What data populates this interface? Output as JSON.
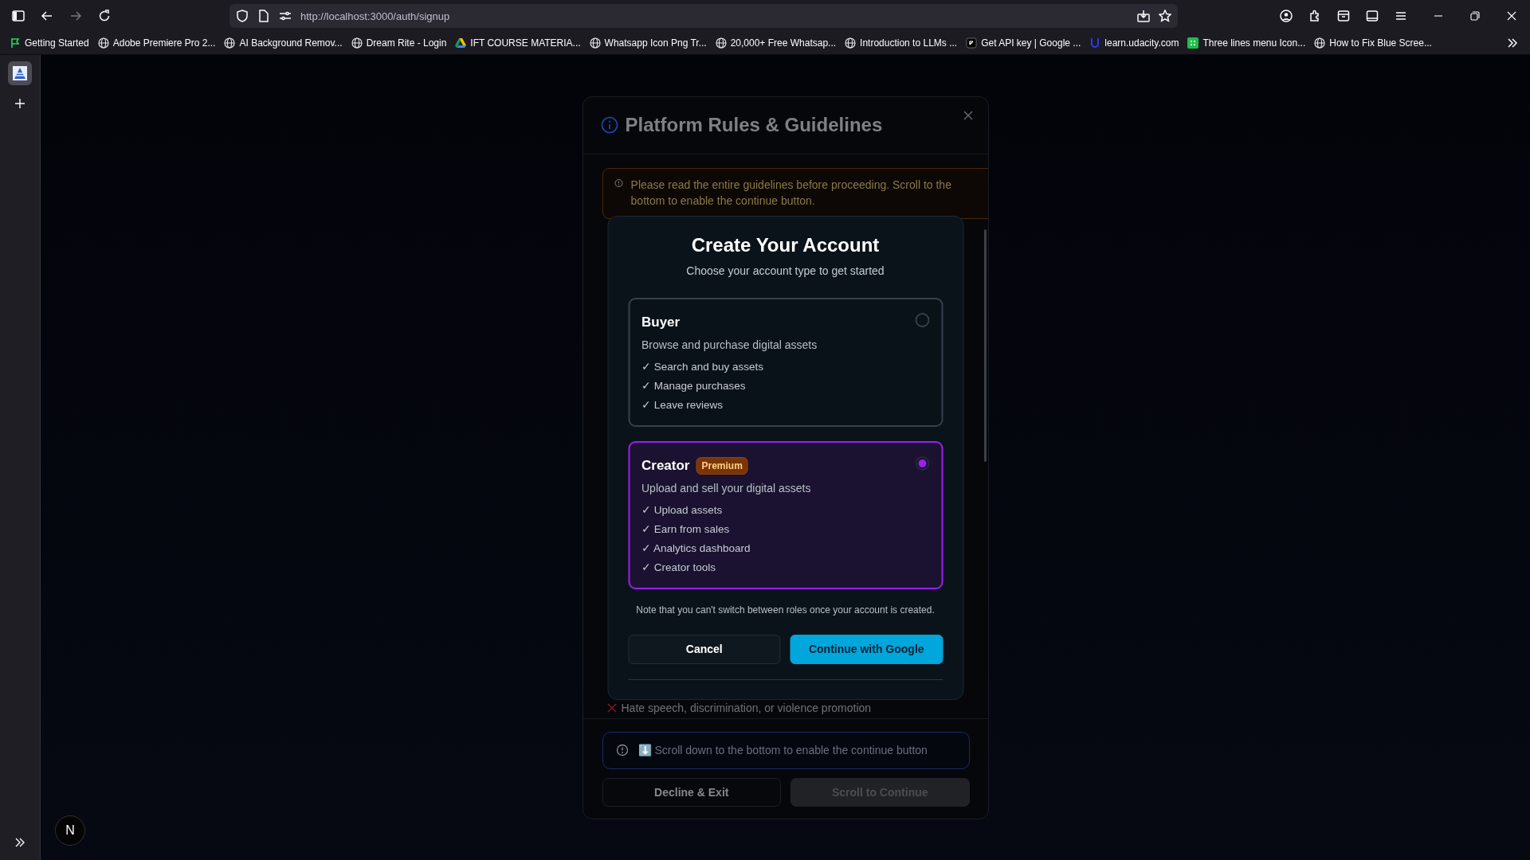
{
  "browser": {
    "url": "http://localhost:3000/auth/signup",
    "bookmarks": [
      {
        "label": "Getting Started",
        "kind": "flag"
      },
      {
        "label": "Adobe Premiere Pro 2...",
        "kind": "globe"
      },
      {
        "label": "AI Background Remov...",
        "kind": "globe"
      },
      {
        "label": "Dream Rite - Login",
        "kind": "globe"
      },
      {
        "label": "IFT COURSE MATERIA...",
        "kind": "drive"
      },
      {
        "label": "Whatsapp Icon Png Tr...",
        "kind": "globe"
      },
      {
        "label": "20,000+ Free Whatsap...",
        "kind": "globe"
      },
      {
        "label": "Introduction to LLMs ...",
        "kind": "globe"
      },
      {
        "label": "Get API key | Google ...",
        "kind": "page"
      },
      {
        "label": "learn.udacity.com",
        "kind": "udacity"
      },
      {
        "label": "Three lines menu Icon...",
        "kind": "sheet"
      },
      {
        "label": "How to Fix Blue Scree...",
        "kind": "globe"
      }
    ]
  },
  "dev_indicator": {
    "letter": "N"
  },
  "guidelines": {
    "title": "Platform Rules & Guidelines",
    "warning": "Please read the entire guidelines before proceeding. Scroll to the bottom to enable the continue button.",
    "visible_rule": "Hate speech, discrimination, or violence promotion",
    "notice": "⬇️ Scroll down to the bottom to enable the continue button",
    "buttons": [
      {
        "label": "Decline & Exit",
        "disabled": false
      },
      {
        "label": "Scroll to Continue",
        "disabled": true
      }
    ]
  },
  "signup": {
    "title": "Create Your Account",
    "subtitle": "Choose your account type to get started",
    "roles": [
      {
        "name": "Buyer",
        "description": "Browse and purchase digital assets",
        "features": [
          "✓ Search and buy assets",
          "✓ Manage purchases",
          "✓ Leave reviews"
        ],
        "selected": false
      },
      {
        "name": "Creator",
        "badge": "Premium",
        "description": "Upload and sell your digital assets",
        "features": [
          "✓ Upload assets",
          "✓ Earn from sales",
          "✓ Analytics dashboard",
          "✓ Creator tools"
        ],
        "selected": true
      }
    ],
    "note": "Note that you can't switch between roles once your account is created.",
    "buttons": [
      {
        "label": "Cancel",
        "kind": "secondary"
      },
      {
        "label": "Continue with Google",
        "kind": "primary"
      }
    ]
  }
}
